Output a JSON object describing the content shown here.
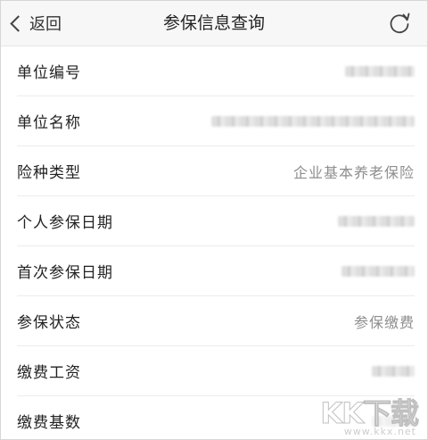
{
  "nav": {
    "back_label": "返回",
    "title": "参保信息查询",
    "refresh_icon": "refresh-icon"
  },
  "rows": [
    {
      "label": "单位编号",
      "value": null
    },
    {
      "label": "单位名称",
      "value": null
    },
    {
      "label": "险种类型",
      "value": "企业基本养老保险"
    },
    {
      "label": "个人参保日期",
      "value": null
    },
    {
      "label": "首次参保日期",
      "value": null
    },
    {
      "label": "参保状态",
      "value": "参保缴费"
    },
    {
      "label": "缴费工资",
      "value": null
    },
    {
      "label": "缴费基数",
      "value": null
    }
  ],
  "watermark": {
    "main": "KK下载",
    "sub": "www.kkx.net"
  },
  "colors": {
    "nav_bg": "#f7f7f8",
    "label": "#222222",
    "value": "#8e8e8e",
    "divider": "#ececec"
  }
}
